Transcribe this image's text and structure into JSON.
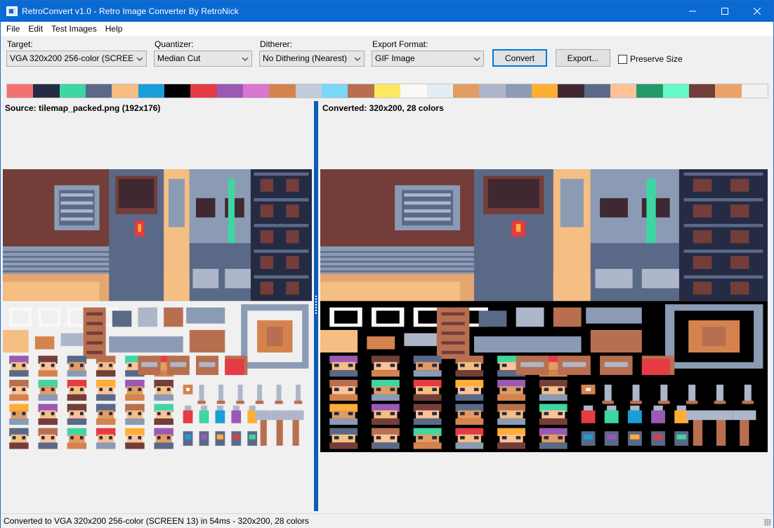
{
  "window": {
    "title": "RetroConvert v1.0 - Retro Image Converter By RetroNick"
  },
  "icons": {
    "app": "app-icon",
    "minimize": "minimize-icon",
    "maximize": "maximize-icon",
    "close": "close-icon",
    "dropdown": "chevron-down-icon"
  },
  "menu": [
    "File",
    "Edit",
    "Test Images",
    "Help"
  ],
  "toolbar": {
    "target_label": "Target:",
    "target_value": "VGA 320x200 256-color (SCREEN 13)",
    "quantizer_label": "Quantizer:",
    "quantizer_value": "Median Cut",
    "ditherer_label": "Ditherer:",
    "ditherer_value": "No Dithering (Nearest)",
    "format_label": "Export Format:",
    "format_value": "GIF Image",
    "convert_label": "Convert",
    "export_label": "Export...",
    "preserve_label": "Preserve Size",
    "preserve_checked": false
  },
  "palette": [
    "#f47171",
    "#262b44",
    "#3ed6a3",
    "#5a6988",
    "#f5be82",
    "#1a9ed8",
    "#000000",
    "#e43b44",
    "#9b59b6",
    "#d977d0",
    "#d4834f",
    "#c0cbdc",
    "#79d7f7",
    "#b86f50",
    "#fee761",
    "#fbf9f5",
    "#e4ecf6",
    "#e29c62",
    "#aeb7c9",
    "#8b9bb4",
    "#feae34",
    "#3f2832",
    "#5a6988",
    "#fcc296",
    "#249a6a",
    "#65fbc8",
    "#733e39",
    "#eba26a",
    "#f0f0f0"
  ],
  "panes": {
    "source_caption": "Source: tilemap_packed.png (192x176)",
    "converted_caption": "Converted: 320x200, 28 colors"
  },
  "status": "Converted to VGA 320x200 256-color (SCREEN 13) in 54ms - 320x200, 28 colors"
}
